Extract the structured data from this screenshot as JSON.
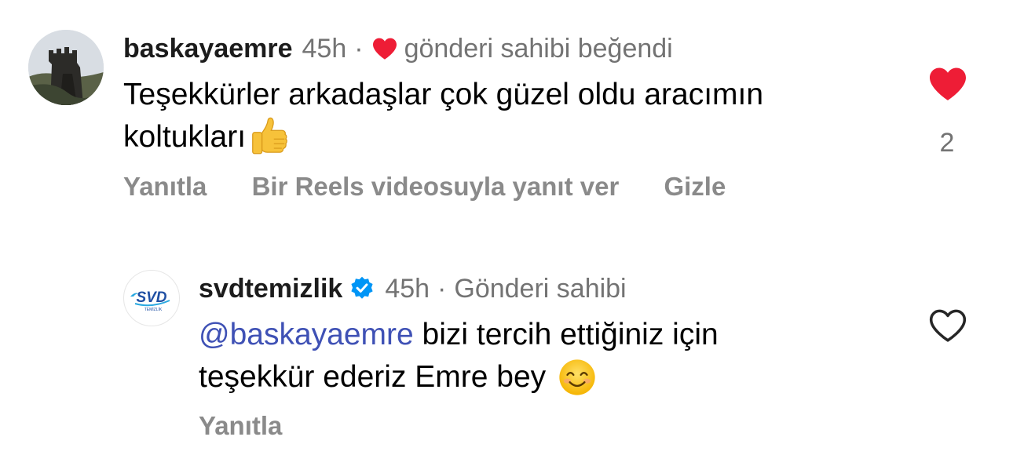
{
  "comments": [
    {
      "username": "baskayaemre",
      "time": "45h",
      "separator": "·",
      "owner_liked_label": "gönderi sahibi beğendi",
      "text": "Teşekkürler arkadaşlar çok güzel oldu aracımın koltukları",
      "text_line1": "Teşekkürler arkadaşlar çok güzel oldu aracımın",
      "text_line2": "koltukları",
      "emoji": "thumbs-up",
      "like_count": "2",
      "liked": true,
      "actions": {
        "reply": "Yanıtla",
        "reels_reply": "Bir Reels videosuyla yanıt ver",
        "hide": "Gizle"
      },
      "avatar": "castle-ruins-photo"
    },
    {
      "username": "svdtemizlik",
      "verified": true,
      "time": "45h",
      "separator": "·",
      "owner_label": "Gönderi sahibi",
      "mention": "@baskayaemre",
      "text_line1_rest": " bizi tercih ettiğiniz için",
      "text_line2": "teşekkür ederiz Emre bey ",
      "emoji": "smiling-face",
      "liked": false,
      "actions": {
        "reply": "Yanıtla"
      },
      "avatar": {
        "logo_text": "SVD",
        "logo_subtext": "TEMİZLİK"
      }
    }
  ],
  "colors": {
    "like_red": "#ee1d36",
    "mention_blue": "#3f51b5",
    "verified_blue": "#0095f6",
    "muted_gray": "#737373"
  }
}
